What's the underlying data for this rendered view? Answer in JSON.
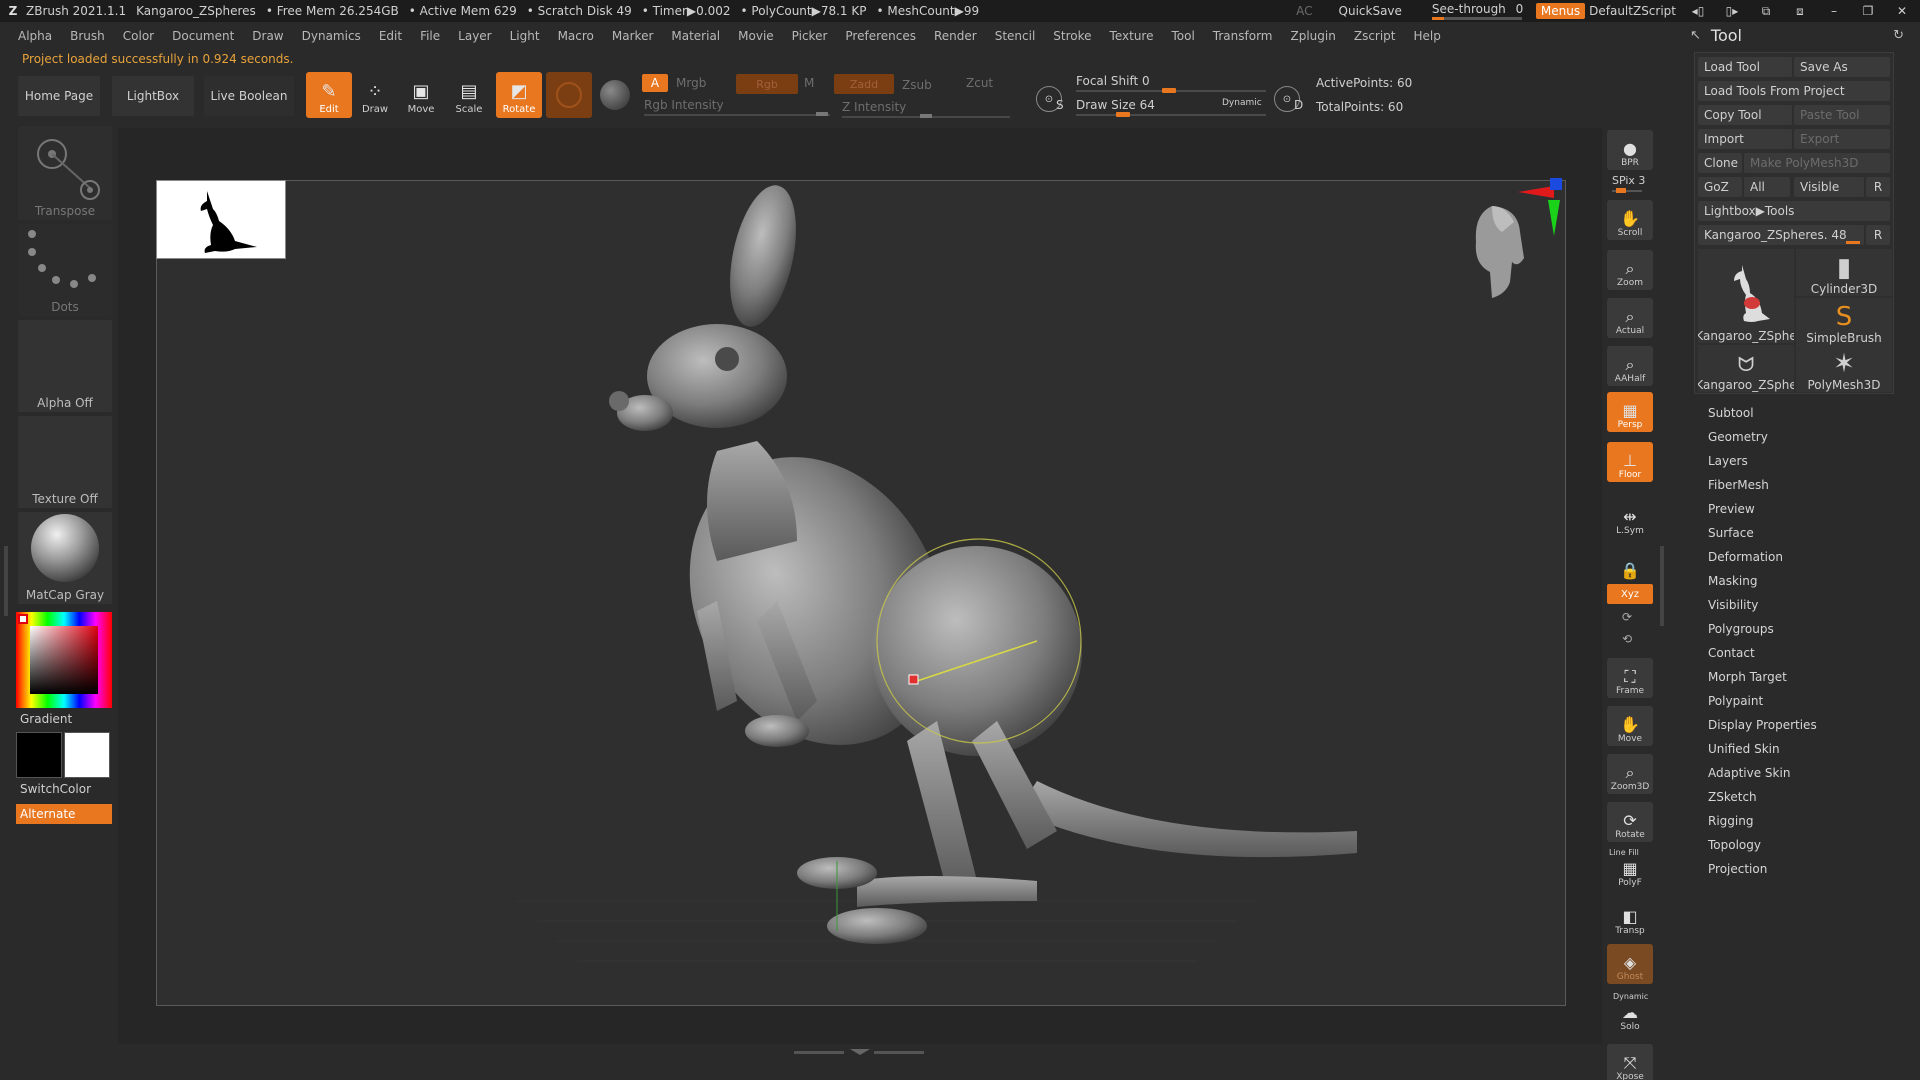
{
  "titlebar": {
    "app": "ZBrush 2021.1.1",
    "document": "Kangaroo_ZSpheres",
    "free_mem": "• Free Mem 26.254GB",
    "active_mem": "• Active Mem 629",
    "scratch": "• Scratch Disk 49",
    "timer": "• Timer▶0.002",
    "polycount": "• PolyCount▶78.1 KP",
    "meshcount": "• MeshCount▶99",
    "ac": "AC",
    "quicksave": "QuickSave",
    "see_through_label": "See-through",
    "see_through_value": "0",
    "see_through_level": 0.0,
    "menus": "Menus",
    "script": "DefaultZScript"
  },
  "menubar": [
    "Alpha",
    "Brush",
    "Color",
    "Document",
    "Draw",
    "Dynamics",
    "Edit",
    "File",
    "Layer",
    "Light",
    "Macro",
    "Marker",
    "Material",
    "Movie",
    "Picker",
    "Preferences",
    "Render",
    "Stencil",
    "Stroke",
    "Texture",
    "Tool",
    "Transform",
    "Zplugin",
    "Zscript",
    "Help"
  ],
  "status_message": "Project loaded successfully in 0.924 seconds.",
  "shelf": {
    "home": "Home Page",
    "lightbox": "LightBox",
    "live_boolean": "Live Boolean",
    "tools": [
      {
        "label": "Edit",
        "active": true
      },
      {
        "label": "Draw",
        "active": false
      },
      {
        "label": "Move",
        "active": false
      },
      {
        "label": "Scale",
        "active": false
      },
      {
        "label": "Rotate",
        "active": true
      }
    ],
    "a_label": "A",
    "mrgb": "Mrgb",
    "rgb": "Rgb",
    "m": "M",
    "zadd": "Zadd",
    "zsub": "Zsub",
    "zcut": "Zcut",
    "rgb_intensity": "Rgb Intensity",
    "z_intensity": "Z Intensity",
    "s_label": "S",
    "focal_shift": "Focal Shift 0",
    "draw_size": "Draw Size 64",
    "dynamic": "Dynamic",
    "d_label": "D",
    "active_points": "ActivePoints: 60",
    "total_points": "TotalPoints: 60"
  },
  "leftpanel": {
    "transpose": "Transpose",
    "dots": "Dots",
    "alpha": "Alpha Off",
    "texture": "Texture Off",
    "material": "MatCap Gray",
    "gradient": "Gradient",
    "switchcolor": "SwitchColor",
    "alternate": "Alternate"
  },
  "rightbar": [
    {
      "label": "BPR",
      "icon": "bpr-icon",
      "state": "normal"
    },
    {
      "label": "Scroll",
      "icon": "scroll-icon",
      "state": "normal"
    },
    {
      "label": "Zoom",
      "icon": "zoom-icon",
      "state": "normal"
    },
    {
      "label": "Actual",
      "icon": "actual-icon",
      "state": "normal"
    },
    {
      "label": "AAHalf",
      "icon": "aahalf-icon",
      "state": "normal"
    },
    {
      "label": "Persp",
      "icon": "persp-icon",
      "state": "on"
    },
    {
      "label": "Floor",
      "icon": "floor-icon",
      "state": "on"
    },
    {
      "label": "L.Sym",
      "icon": "lsym-icon",
      "state": "flat"
    },
    {
      "label": "",
      "icon": "lock-icon",
      "state": "flat"
    },
    {
      "label": "Frame",
      "icon": "frame-icon",
      "state": "normal"
    },
    {
      "label": "Move",
      "icon": "move-icon",
      "state": "normal"
    },
    {
      "label": "Zoom3D",
      "icon": "zoom3d-icon",
      "state": "normal"
    },
    {
      "label": "Rotate",
      "icon": "rotate-icon",
      "state": "normal"
    },
    {
      "label": "PolyF",
      "icon": "polyf-icon",
      "state": "flat"
    },
    {
      "label": "Transp",
      "icon": "transp-icon",
      "state": "flat"
    },
    {
      "label": "Ghost",
      "icon": "ghost-icon",
      "state": "dimon"
    },
    {
      "label": "Solo",
      "icon": "solo-icon",
      "state": "flat"
    },
    {
      "label": "Xpose",
      "icon": "xpose-icon",
      "state": "normal"
    }
  ],
  "spix": "SPix 3",
  "xyz": "Xyz",
  "linefill": "Line Fill",
  "dynamic_small": "Dynamic",
  "toolpanel": {
    "title": "Tool",
    "load_tool": "Load Tool",
    "save_as": "Save As",
    "load_from_project": "Load Tools From Project",
    "copy_tool": "Copy Tool",
    "paste_tool": "Paste Tool",
    "import": "Import",
    "export": "Export",
    "clone": "Clone",
    "make_polymesh": "Make PolyMesh3D",
    "goz": "GoZ",
    "all": "All",
    "visible": "Visible",
    "r": "R",
    "lightbox_tools": "Lightbox▶Tools",
    "current_tool": "Kangaroo_ZSpheres. 48",
    "thumbs": [
      {
        "label": "Kangaroo_ZSphe",
        "icon": "kangaroo-icon"
      },
      {
        "label": "Cylinder3D",
        "icon": "cylinder-icon"
      },
      {
        "label": "SimpleBrush",
        "icon": "simplebrush-icon"
      },
      {
        "label": "Kangaroo_ZSphe",
        "icon": "kangaroo-small-icon"
      },
      {
        "label": "PolyMesh3D",
        "icon": "polymesh-icon"
      }
    ],
    "menu": [
      "Subtool",
      "Geometry",
      "Layers",
      "FiberMesh",
      "Preview",
      "Surface",
      "Deformation",
      "Masking",
      "Visibility",
      "Polygroups",
      "Contact",
      "Morph Target",
      "Polypaint",
      "Display Properties",
      "Unified Skin",
      "Adaptive Skin",
      "ZSketch",
      "Rigging",
      "Topology",
      "Projection"
    ]
  },
  "colors": {
    "accent": "#e8771f",
    "background": "#2a2a2a",
    "panel": "#333333"
  }
}
